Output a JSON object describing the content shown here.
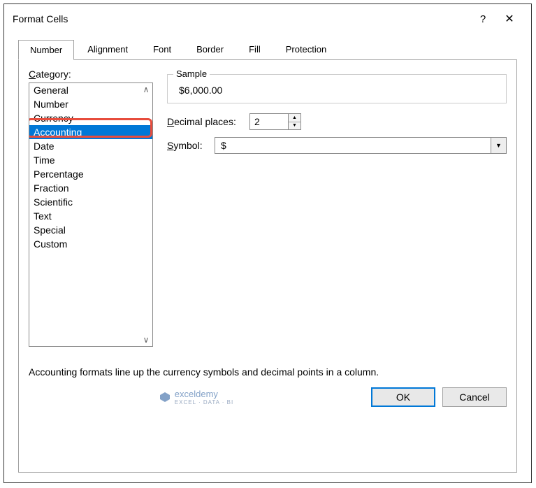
{
  "title": "Format Cells",
  "tabs": [
    "Number",
    "Alignment",
    "Font",
    "Border",
    "Fill",
    "Protection"
  ],
  "active_tab": 0,
  "category_label": "Category:",
  "categories": [
    "General",
    "Number",
    "Currency",
    "Accounting",
    "Date",
    "Time",
    "Percentage",
    "Fraction",
    "Scientific",
    "Text",
    "Special",
    "Custom"
  ],
  "selected_category_index": 3,
  "sample_label": "Sample",
  "sample_value": "$6,000.00",
  "decimal_label": "Decimal places:",
  "decimal_value": "2",
  "symbol_label": "Symbol:",
  "symbol_value": "$",
  "description": "Accounting formats line up the currency symbols and decimal points in a column.",
  "watermark_text": "exceldemy",
  "watermark_sub": "EXCEL · DATA · BI",
  "buttons": {
    "ok": "OK",
    "cancel": "Cancel"
  }
}
